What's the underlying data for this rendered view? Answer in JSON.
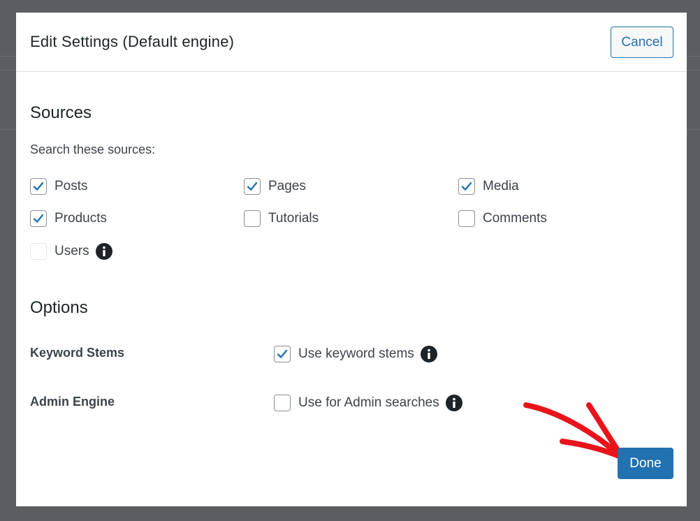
{
  "modal": {
    "title": "Edit Settings (Default engine)",
    "cancel_label": "Cancel",
    "done_label": "Done"
  },
  "sources": {
    "title": "Sources",
    "subtitle": "Search these sources:",
    "items": [
      {
        "label": "Posts",
        "checked": true
      },
      {
        "label": "Pages",
        "checked": true
      },
      {
        "label": "Media",
        "checked": true
      },
      {
        "label": "Products",
        "checked": true
      },
      {
        "label": "Tutorials",
        "checked": false
      },
      {
        "label": "Comments",
        "checked": false
      },
      {
        "label": "Users",
        "checked": false,
        "disabled": true,
        "info_icon": "info-icon"
      }
    ]
  },
  "options": {
    "title": "Options",
    "rows": [
      {
        "label": "Keyword Stems",
        "checkbox_label": "Use keyword stems",
        "checked": true,
        "info_icon": "info-icon"
      },
      {
        "label": "Admin Engine",
        "checkbox_label": "Use for Admin searches",
        "checked": false,
        "info_icon": "info-icon"
      }
    ]
  },
  "colors": {
    "accent": "#2271b1",
    "annotation_arrow": "#e8131b",
    "overlay": "#5b5d61"
  }
}
